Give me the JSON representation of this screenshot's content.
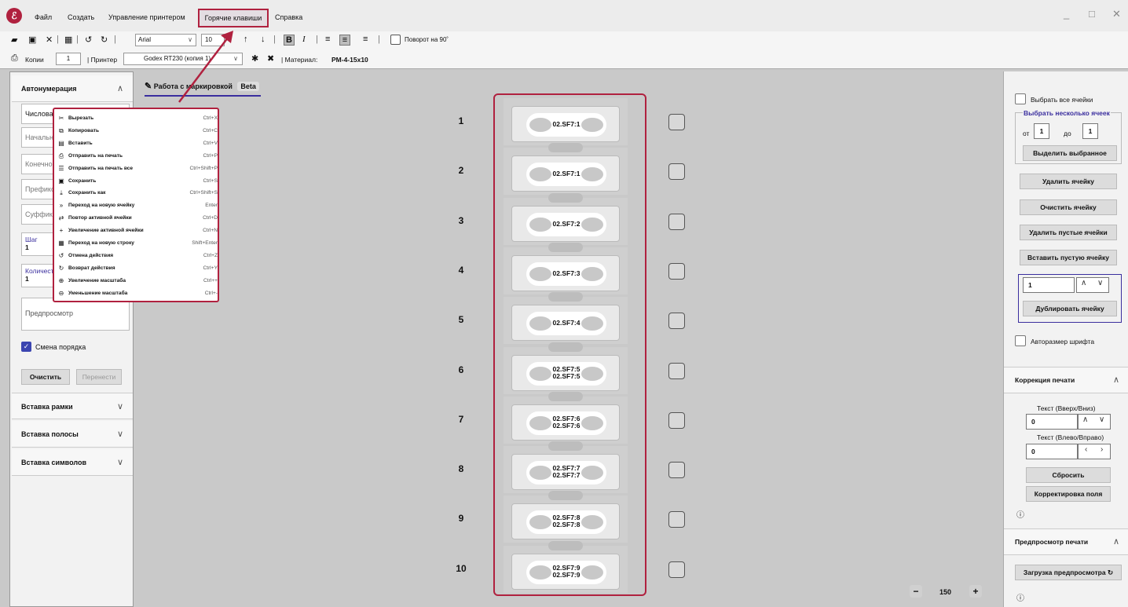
{
  "menubar": {
    "items": [
      "Файл",
      "Создать",
      "Управление принтером",
      "Горячие клавиши",
      "Справка"
    ],
    "window_controls": [
      "_",
      "□",
      "✕"
    ]
  },
  "toolbar": {
    "font": "Arial",
    "font_size": "10",
    "rotate_label": "Поворот на 90˚"
  },
  "toolbar2": {
    "copies_label": "Копии",
    "copies_value": "1",
    "printer_label": "| Принтер",
    "printer_value": "Godex RT230 (копия 1)",
    "material_label": "| Материал:",
    "material_value": "PM-4-15x10"
  },
  "sidebar_left": {
    "autonumbering": "Автонумерация",
    "fields": [
      "Числовая",
      "Начально",
      "Конечно",
      "Префикс",
      "Суффикс"
    ],
    "step_label": "Шаг",
    "step_value": "1",
    "count_label": "Количест",
    "count_value": "1",
    "preview": "Предпросмотр",
    "order_change": "Смена порядка",
    "clear": "Очистить",
    "transfer": "Перенести",
    "insert_frame": "Вставка рамки",
    "insert_strip": "Вставка полосы",
    "insert_symbols": "Вставка символов"
  },
  "context_menu": [
    {
      "icon": "scissors-icon",
      "glyph": "✂",
      "label": "Вырезать",
      "shortcut": "Ctrl+X"
    },
    {
      "icon": "copy-icon",
      "glyph": "⧉",
      "label": "Копировать",
      "shortcut": "Ctrl+C"
    },
    {
      "icon": "paste-icon",
      "glyph": "▤",
      "label": "Вставить",
      "shortcut": "Ctrl+V"
    },
    {
      "icon": "printer-icon",
      "glyph": "⎙",
      "label": "Отправить на печать",
      "shortcut": "Ctrl+P"
    },
    {
      "icon": "print-all-icon",
      "glyph": "☰",
      "label": "Отправить на печать все",
      "shortcut": "Ctrl+Shift+P"
    },
    {
      "icon": "save-icon",
      "glyph": "▣",
      "label": "Сохранить",
      "shortcut": "Ctrl+S"
    },
    {
      "icon": "save-as-icon",
      "glyph": "⤓",
      "label": "Сохранить как",
      "shortcut": "Ctrl+Shift+S"
    },
    {
      "icon": "double-chevron-icon",
      "glyph": "»",
      "label": "Переход на новую ячейку",
      "shortcut": "Enter"
    },
    {
      "icon": "repeat-icon",
      "glyph": "⇄",
      "label": "Повтор активной ячейки",
      "shortcut": "Ctrl+D"
    },
    {
      "icon": "plus-icon",
      "glyph": "+",
      "label": "Увеличение активной ячейки",
      "shortcut": "Ctrl+N"
    },
    {
      "icon": "new-row-icon",
      "glyph": "▦",
      "label": "Переход на новую строку",
      "shortcut": "Shift+Enter"
    },
    {
      "icon": "undo-icon",
      "glyph": "↺",
      "label": "Отмена действия",
      "shortcut": "Ctrl+Z"
    },
    {
      "icon": "redo-icon",
      "glyph": "↻",
      "label": "Возврат действия",
      "shortcut": "Ctrl+Y"
    },
    {
      "icon": "zoom-in-icon",
      "glyph": "⊕",
      "label": "Увеличение масштаба",
      "shortcut": "Ctrl++"
    },
    {
      "icon": "zoom-out-icon",
      "glyph": "⊖",
      "label": "Уменьшение масштаба",
      "shortcut": "Ctrl+-"
    }
  ],
  "work": {
    "tab_label": "Работа с маркировкой",
    "beta": "Beta",
    "labels": [
      {
        "num": "1",
        "lines": [
          "02.SF7:1"
        ]
      },
      {
        "num": "2",
        "lines": [
          "02.SF7:1"
        ]
      },
      {
        "num": "3",
        "lines": [
          "02.SF7:2"
        ]
      },
      {
        "num": "4",
        "lines": [
          "02.SF7:3"
        ]
      },
      {
        "num": "5",
        "lines": [
          "02.SF7:4"
        ]
      },
      {
        "num": "6",
        "lines": [
          "02.SF7:5",
          "02.SF7:5"
        ]
      },
      {
        "num": "7",
        "lines": [
          "02.SF7:6",
          "02.SF7:6"
        ]
      },
      {
        "num": "8",
        "lines": [
          "02.SF7:7",
          "02.SF7:7"
        ]
      },
      {
        "num": "9",
        "lines": [
          "02.SF7:8",
          "02.SF7:8"
        ]
      },
      {
        "num": "10",
        "lines": [
          "02.SF7:9",
          "02.SF7:9"
        ]
      }
    ],
    "zoom": "150"
  },
  "sidebar_right": {
    "select_all": "Выбрать все ячейки",
    "select_multiple": "Выбрать несколько ячеек",
    "from_label": "от",
    "from_value": "1",
    "to_label": "до",
    "to_value": "1",
    "highlight_selected": "Выделить выбранное",
    "delete_cell": "Удалить ячейку",
    "clear_cell": "Очистить ячейку",
    "delete_empty": "Удалить пустые ячейки",
    "insert_empty": "Вставить пустую ячейку",
    "dup_value": "1",
    "duplicate_cell": "Дублировать ячейку",
    "autosize_font": "Авторазмер шрифта",
    "print_correction": "Коррекция печати",
    "text_updown": "Текст (Вверх/Вниз)",
    "updown_value": "0",
    "text_leftright": "Текст (Влево/Вправо)",
    "leftright_value": "0",
    "reset": "Сбросить",
    "field_correction": "Корректировка поля",
    "print_preview": "Предпросмотр печати",
    "load_preview": "Загрузка предпросмотра"
  },
  "colors": {
    "accent": "#b0213f",
    "link": "#3a2e9e"
  }
}
